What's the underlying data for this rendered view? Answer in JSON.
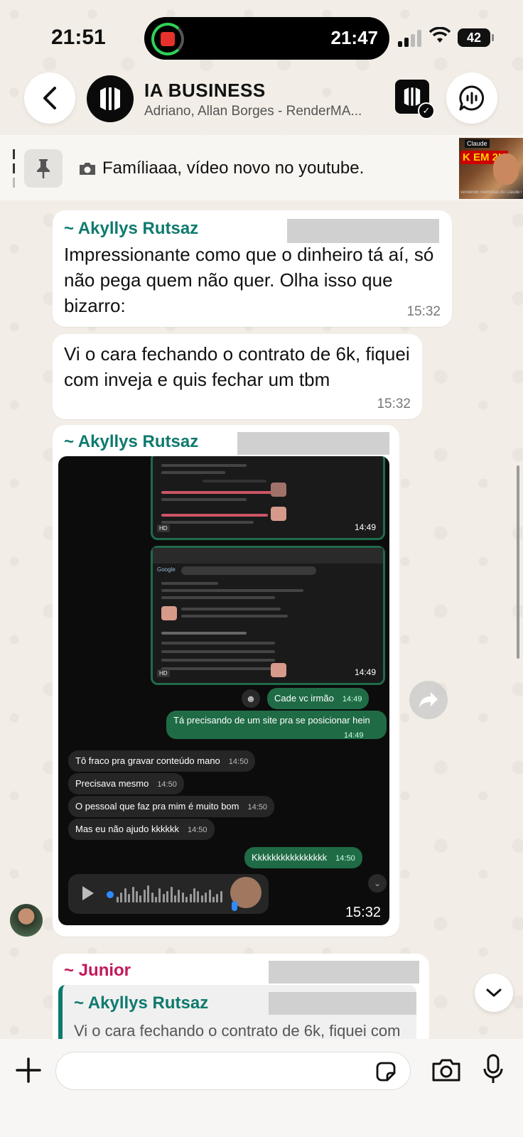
{
  "status_bar": {
    "time_left": "21:51",
    "island_time": "21:47",
    "battery": "42"
  },
  "header": {
    "title": "IA BUSINESS",
    "subtitle": "Adriano, Allan Borges - RenderMA..."
  },
  "pinned": {
    "text": "Famíliaaa, vídeo novo no youtube.",
    "thumb_top": "Claude",
    "thumb_headline": "K EM 2H",
    "thumb_caption": "vendendo memorias do Claude Code (2k em 1h)"
  },
  "messages": [
    {
      "sender": "~ Akyllys Rutsaz",
      "text": "Impressionante como que o dinheiro tá aí, só não pega quem não quer. Olha isso que bizarro:",
      "time": "15:32"
    },
    {
      "text": "Vi o cara fechando o contrato de 6k, fiquei com inveja e quis fechar um tbm",
      "time": "15:32"
    },
    {
      "sender": "~ Akyllys Rutsaz",
      "time": "15:32",
      "screenshot": {
        "card1_time": "14:49",
        "card2_time": "14:49",
        "chats": [
          {
            "text": "Cade vc irmão",
            "time": "14:49",
            "dir": "out"
          },
          {
            "text": "Tá precisando de um site pra se posicionar hein",
            "time": "14:49",
            "dir": "out"
          },
          {
            "text": "Tô fraco pra gravar conteúdo mano",
            "time": "14:50",
            "dir": "in"
          },
          {
            "text": "Precisava mesmo",
            "time": "14:50",
            "dir": "in"
          },
          {
            "text": "O pessoal que faz pra mim é muito bom",
            "time": "14:50",
            "dir": "in"
          },
          {
            "text": "Mas eu não ajudo kkkkkk",
            "time": "14:50",
            "dir": "in"
          },
          {
            "text": "Kkkkkkkkkkkkkkkk",
            "time": "14:50",
            "dir": "out"
          }
        ]
      }
    },
    {
      "sender": "~ Junior",
      "quote_sender": "~ Akyllys Rutsaz",
      "quote_text": "Vi o cara fechando o contrato de 6k, fiquei com"
    }
  ],
  "icons": {
    "back": "chevron-left",
    "call": "audio-call",
    "pin": "pin",
    "camera": "camera",
    "forward": "share",
    "scroll": "chevron-down",
    "plus": "plus",
    "sticker": "sticker",
    "mic": "microphone"
  },
  "colors": {
    "sender_green": "#0e7a6e",
    "sender_red": "#c2185b",
    "outgoing_dark": "#1f6b45"
  }
}
